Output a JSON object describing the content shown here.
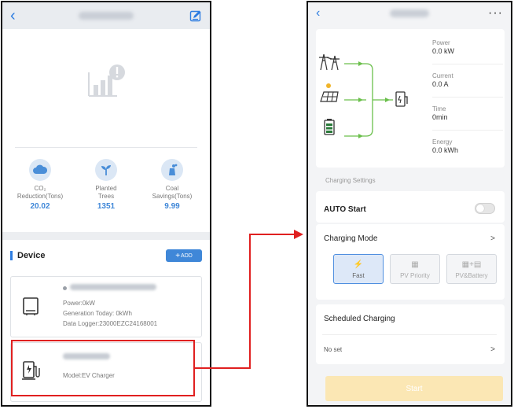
{
  "left_screen": {
    "header": {
      "back_icon": "chevron-left-icon",
      "edit_icon": "edit-icon"
    },
    "stats": [
      {
        "label_line1": "CO₂",
        "label_line2": "Reduction(Tons)",
        "value": "20.02"
      },
      {
        "label_line1": "Planted",
        "label_line2": "Trees",
        "value": "1351"
      },
      {
        "label_line1": "Coal",
        "label_line2": "Savings(Tons)",
        "value": "9.99"
      }
    ],
    "device_section": {
      "title": "Device",
      "add_label": "ADD"
    },
    "devices": [
      {
        "power": "Power:0kW",
        "generation": "Generation Today: 0kWh",
        "logger": "Data Logger:23000EZC24168001"
      },
      {
        "model": "Model:EV Charger"
      }
    ],
    "colors": {
      "accent": "#3f87d8",
      "highlight": "#e02020"
    }
  },
  "right_screen": {
    "header": {
      "back_icon": "chevron-left-icon",
      "menu_icon": "more-dots-icon",
      "menu_label": "···"
    },
    "metrics": [
      {
        "label": "Power",
        "value": "0.0 kW"
      },
      {
        "label": "Current",
        "value": "0.0 A"
      },
      {
        "label": "Time",
        "value": "0min"
      },
      {
        "label": "Energy",
        "value": "0.0 kWh"
      }
    ],
    "charging_settings_label": "Charging Settings",
    "auto_start_label": "AUTO Start",
    "charging_mode_label": "Charging Mode",
    "modes": [
      {
        "label": "Fast",
        "selected": true
      },
      {
        "label": "PV Priority",
        "selected": false
      },
      {
        "label": "PV&Battery",
        "selected": false
      }
    ],
    "scheduled_title": "Scheduled Charging",
    "scheduled_value": "No set",
    "chevron": ">",
    "start_label": "Start"
  }
}
